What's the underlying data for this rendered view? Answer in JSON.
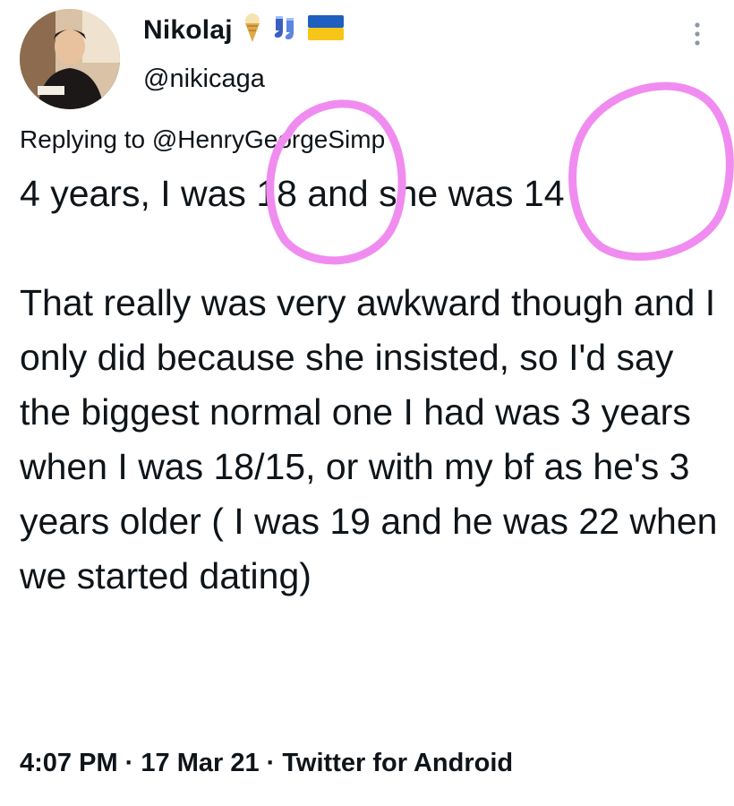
{
  "author": {
    "display_name": "Nikolaj",
    "emoji": [
      "ice-cream-icon",
      "socks-icon",
      "ukraine-flag-icon"
    ],
    "handle": "@nikicaga"
  },
  "reply": {
    "prefix": "Replying to ",
    "mention": "@HenryGeorgeSimp"
  },
  "tweet": {
    "text": "4 years, I was 18 and she was 14\n\nThat really was very awkward though and I only did because she insisted, so I'd say the biggest normal one I had was 3 years when I was 18/15, or with my bf as he's 3 years older ( I was 19 and he was 22 when we started dating)"
  },
  "meta": {
    "time": "4:07 PM",
    "separator": " · ",
    "date": "17 Mar 21",
    "source": "Twitter for Android"
  },
  "colors": {
    "annotation": "#f08cf0",
    "flag_blue": "#1f5fbf",
    "flag_yellow": "#f5c518"
  }
}
